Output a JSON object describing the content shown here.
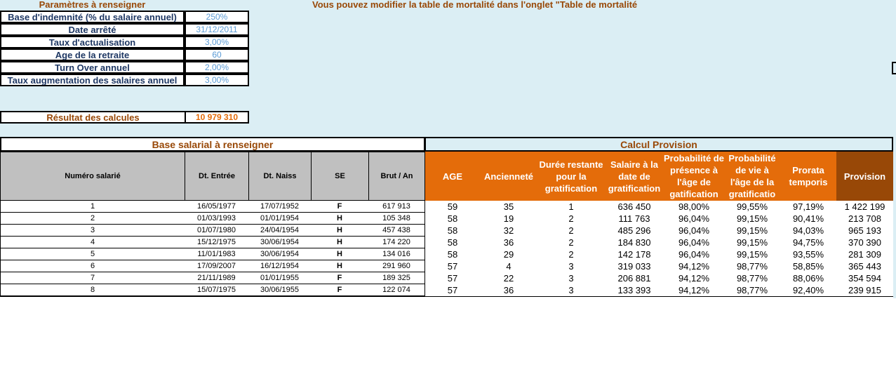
{
  "params": {
    "title": "Paramètres à renseigner",
    "items": [
      {
        "label": "Base d'indemnité (% du salaire annuel)",
        "value": "250%"
      },
      {
        "label": "Date arrêté",
        "value": "31/12/2011"
      },
      {
        "label": "Taux d'actualisation",
        "value": "3,00%"
      },
      {
        "label": "Age de la retraite",
        "value": "60"
      },
      {
        "label": "Turn Over annuel",
        "value": "2,00%"
      },
      {
        "label": "Taux augmentation des salaires annuel",
        "value": "3,00%"
      }
    ]
  },
  "notice": "Vous pouvez modifier la table de mortalité dans l'onglet \"Table de mortalité",
  "result": {
    "label": "Résultat des calcules",
    "value": "10 979 310"
  },
  "section_left": "Base salarial à renseigner",
  "section_right": "Calcul Provision",
  "left_headers": [
    "Numéro salarié",
    "Dt. Entrée",
    "Dt. Naiss",
    "SE",
    "Brut / An"
  ],
  "right_headers": [
    "AGE",
    "Ancienneté",
    "Durée restante pour la gratification",
    "Salaire à la date de gratification",
    "Probabilité de présence à l'âge de gatification",
    "Probabilité de vie à l'âge de la gratificatio",
    "Prorata temporis",
    "Provision"
  ],
  "rows": [
    {
      "num": "1",
      "entree": "16/05/1977",
      "naiss": "17/07/1952",
      "se": "F",
      "brut": "617 913",
      "age": "59",
      "anc": "35",
      "duree": "1",
      "salaire": "636 450",
      "presence": "98,00%",
      "vie": "99,55%",
      "prorata": "97,19%",
      "provision": "1 422 199"
    },
    {
      "num": "2",
      "entree": "01/03/1993",
      "naiss": "01/01/1954",
      "se": "H",
      "brut": "105 348",
      "age": "58",
      "anc": "19",
      "duree": "2",
      "salaire": "111 763",
      "presence": "96,04%",
      "vie": "99,15%",
      "prorata": "90,41%",
      "provision": "213 708"
    },
    {
      "num": "3",
      "entree": "01/07/1980",
      "naiss": "24/04/1954",
      "se": "H",
      "brut": "457 438",
      "age": "58",
      "anc": "32",
      "duree": "2",
      "salaire": "485 296",
      "presence": "96,04%",
      "vie": "99,15%",
      "prorata": "94,03%",
      "provision": "965 193"
    },
    {
      "num": "4",
      "entree": "15/12/1975",
      "naiss": "30/06/1954",
      "se": "H",
      "brut": "174 220",
      "age": "58",
      "anc": "36",
      "duree": "2",
      "salaire": "184 830",
      "presence": "96,04%",
      "vie": "99,15%",
      "prorata": "94,75%",
      "provision": "370 390"
    },
    {
      "num": "5",
      "entree": "11/01/1983",
      "naiss": "30/06/1954",
      "se": "H",
      "brut": "134 016",
      "age": "58",
      "anc": "29",
      "duree": "2",
      "salaire": "142 178",
      "presence": "96,04%",
      "vie": "99,15%",
      "prorata": "93,55%",
      "provision": "281 309"
    },
    {
      "num": "6",
      "entree": "17/09/2007",
      "naiss": "16/12/1954",
      "se": "H",
      "brut": "291 960",
      "age": "57",
      "anc": "4",
      "duree": "3",
      "salaire": "319 033",
      "presence": "94,12%",
      "vie": "98,77%",
      "prorata": "58,85%",
      "provision": "365 443"
    },
    {
      "num": "7",
      "entree": "21/11/1989",
      "naiss": "01/01/1955",
      "se": "F",
      "brut": "189 325",
      "age": "57",
      "anc": "22",
      "duree": "3",
      "salaire": "206 881",
      "presence": "94,12%",
      "vie": "98,77%",
      "prorata": "88,06%",
      "provision": "354 594"
    },
    {
      "num": "8",
      "entree": "15/07/1975",
      "naiss": "30/06/1955",
      "se": "F",
      "brut": "122 074",
      "age": "57",
      "anc": "36",
      "duree": "3",
      "salaire": "133 393",
      "presence": "94,12%",
      "vie": "98,77%",
      "prorata": "92,40%",
      "provision": "239 915"
    }
  ],
  "colors": {
    "orange": "#e46c0a",
    "brown": "#984807",
    "sheet_bg": "#dbeef4",
    "value_blue": "#5b9bd5",
    "label_navy": "#1f3864"
  }
}
